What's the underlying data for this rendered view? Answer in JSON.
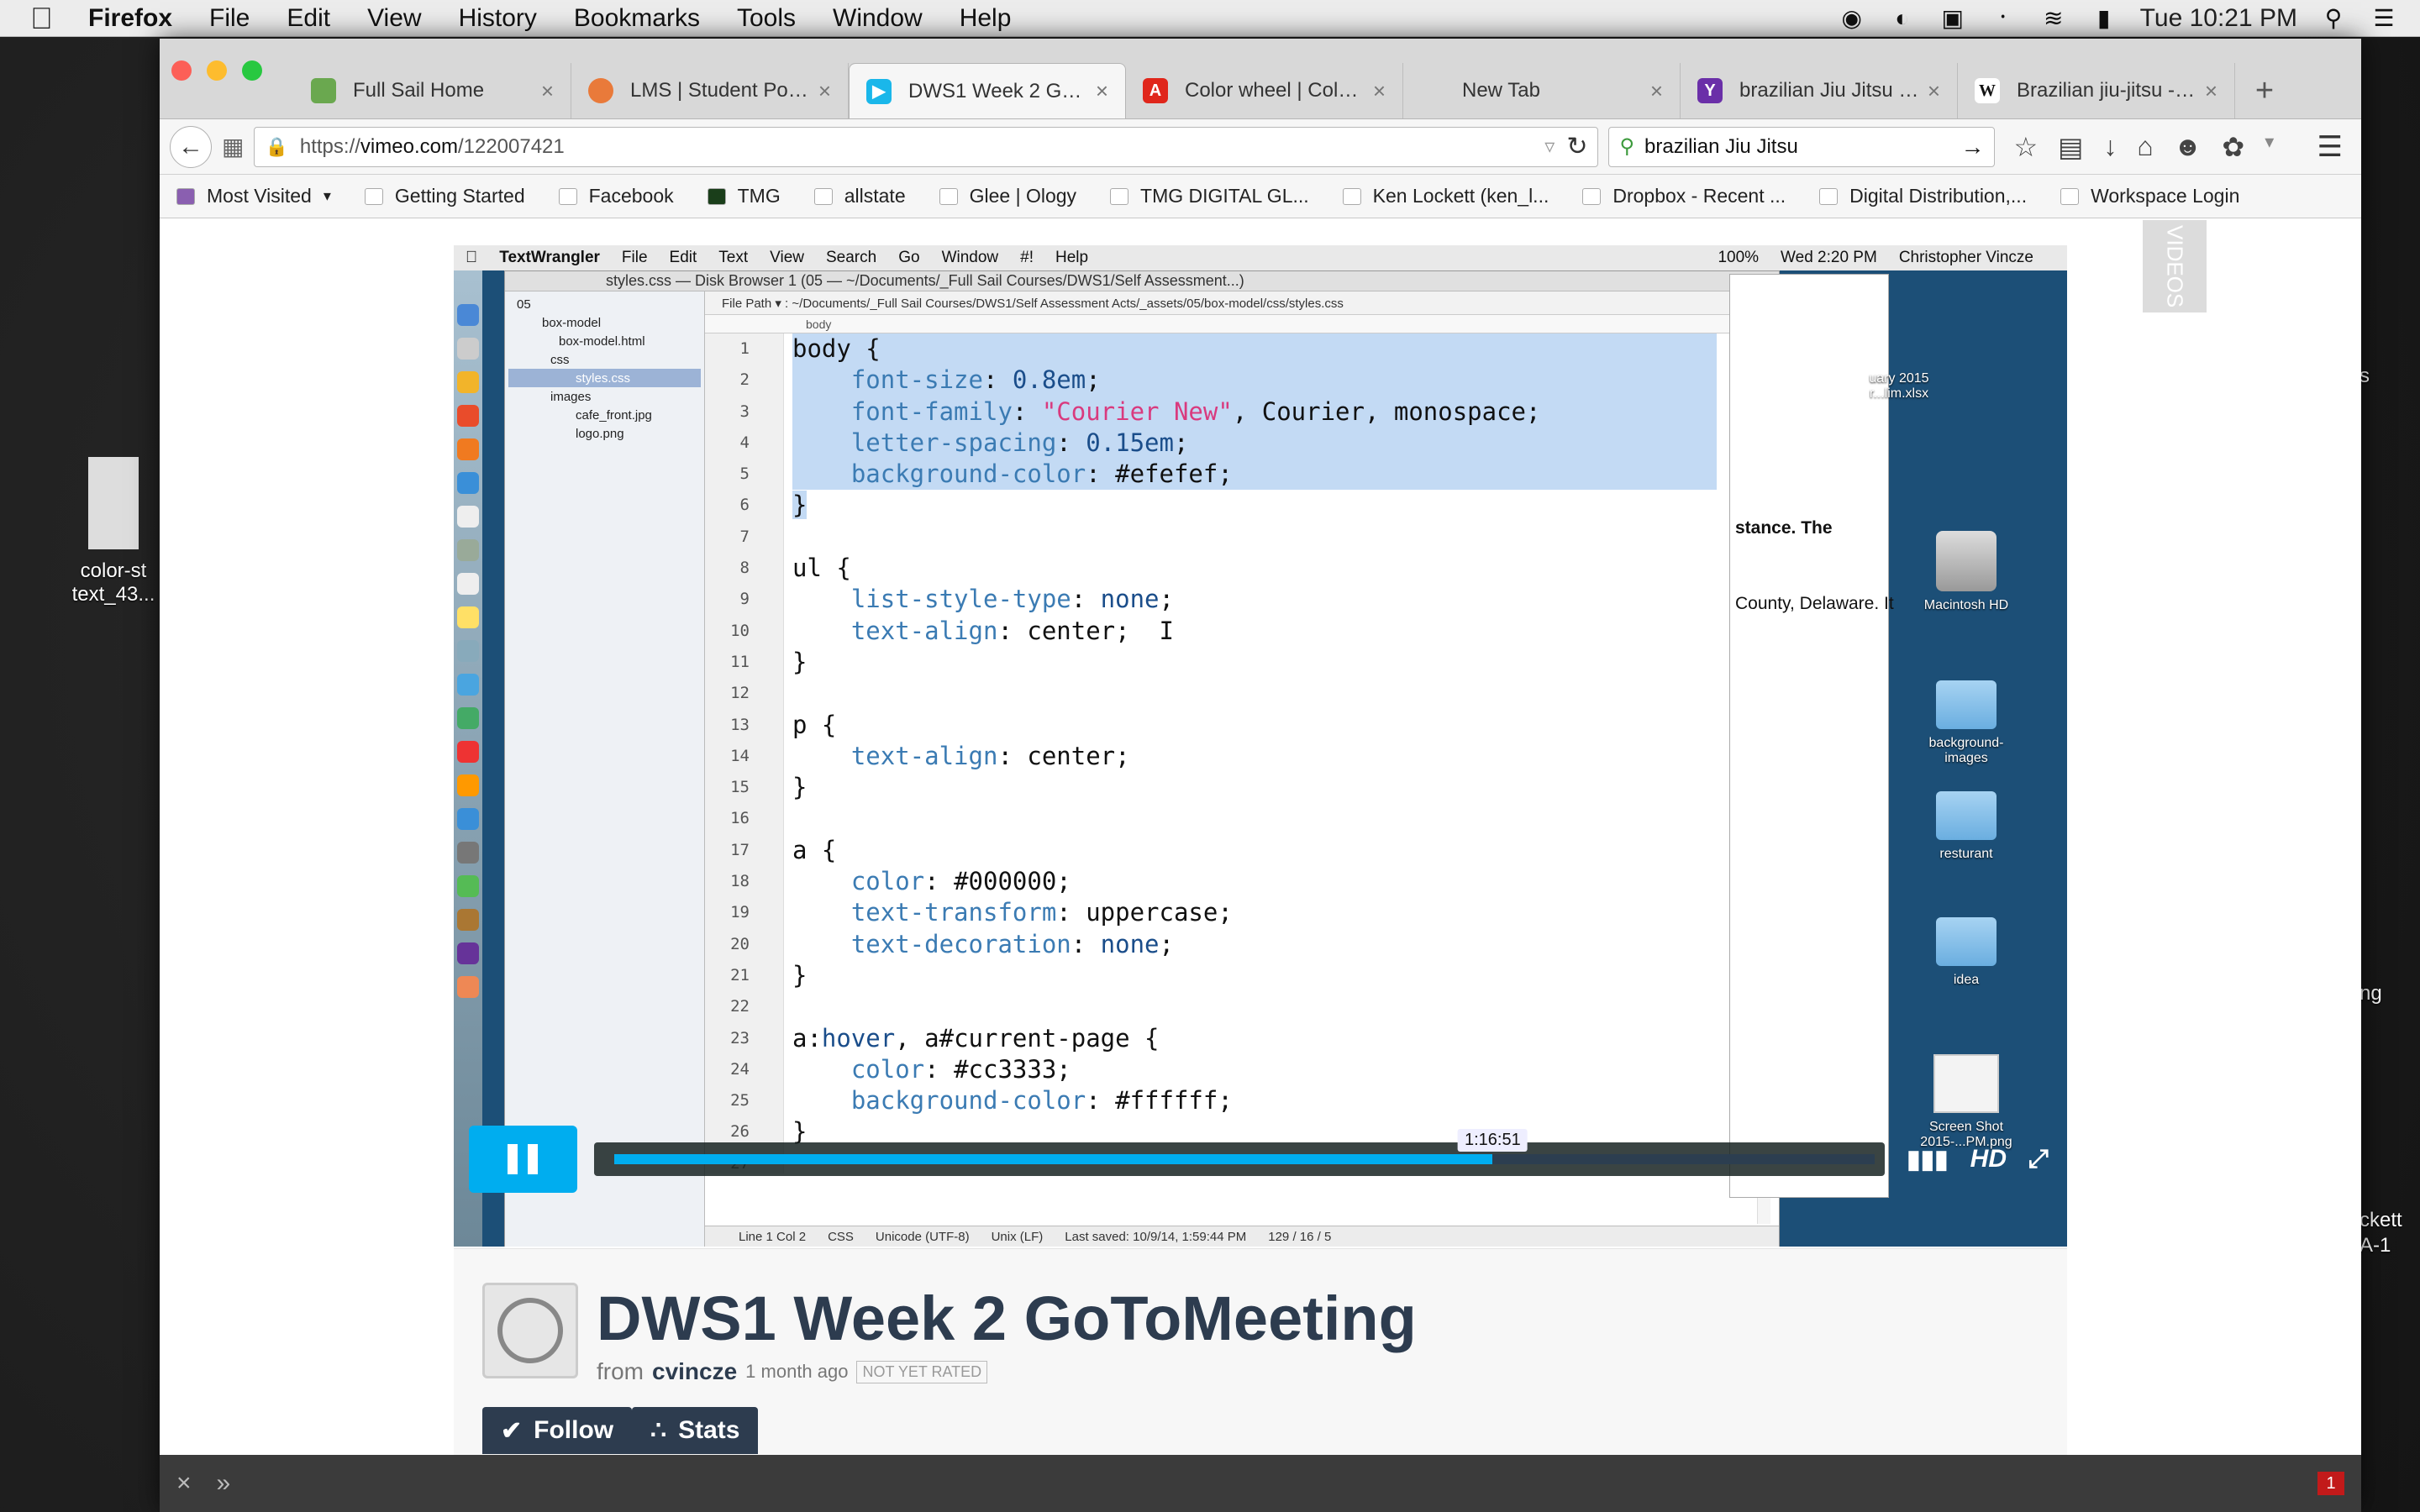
{
  "menubar": {
    "app": "Firefox",
    "items": [
      "File",
      "Edit",
      "View",
      "History",
      "Bookmarks",
      "Tools",
      "Window",
      "Help"
    ],
    "clock": "Tue 10:21 PM"
  },
  "desktop_left": {
    "label1": "color-st",
    "label2": "text_43..."
  },
  "desktop_right": {
    "label1": "ckett",
    "label2": "A-1",
    "label3": "ng",
    "label4": "s"
  },
  "tabs": [
    {
      "label": "Full Sail Home",
      "color": "#6aa84f"
    },
    {
      "label": "LMS | Student Portal",
      "color": "#e97a3a"
    },
    {
      "label": "DWS1 Week 2 GoT...",
      "color": "#1ab7ea"
    },
    {
      "label": "Color wheel | Color...",
      "color": "#e0261b"
    },
    {
      "label": "New Tab",
      "color": "#d8d8d8"
    },
    {
      "label": "brazilian Jiu Jitsu - ...",
      "color": "#6a2fa8"
    },
    {
      "label": "Brazilian jiu-jitsu - ...",
      "color": "#555555"
    }
  ],
  "nav": {
    "url_prefix": "https://",
    "url_host": "vimeo.com",
    "url_path": "/122007421",
    "search_value": "brazilian Jiu Jitsu"
  },
  "bookmarks": [
    "Most Visited",
    "Getting Started",
    "Facebook",
    "TMG",
    "allstate",
    "Glee | Ology",
    "TMG DIGITAL GL...",
    "Ken Lockett (ken_l...",
    "Dropbox - Recent ...",
    "Digital Distribution,...",
    "Workspace Login"
  ],
  "textwrangler": {
    "menu": [
      "TextWrangler",
      "File",
      "Edit",
      "Text",
      "View",
      "Search",
      "Go",
      "Window",
      "#!",
      "Help"
    ],
    "clock": "Wed 2:20 PM",
    "user": "Christopher Vincze",
    "battery": "100%",
    "window_title": "styles.css — Disk Browser 1 (05 — ~/Documents/_Full Sail Courses/DWS1/Self Assessment...)",
    "file_path": "File Path ▾ : ~/Documents/_Full Sail Courses/DWS1/Self Assessment Acts/_assets/05/box-model/css/styles.css",
    "crumb": "body",
    "tree": [
      "05",
      "box-model",
      "box-model.html",
      "css",
      "styles.css",
      "images",
      "cafe_front.jpg",
      "logo.png"
    ],
    "status": [
      "Line 1 Col 2",
      "CSS",
      "Unicode (UTF-8)",
      "Unix (LF)",
      "Last saved: 10/9/14, 1:59:44 PM",
      "129 / 16 / 5"
    ],
    "line_numbers": [
      "1",
      "2",
      "3",
      "4",
      "5",
      "6",
      "7",
      "8",
      "9",
      "10",
      "11",
      "12",
      "13",
      "14",
      "15",
      "16",
      "17",
      "18",
      "19",
      "20",
      "21",
      "22",
      "23",
      "24",
      "25",
      "26",
      "27"
    ]
  },
  "preview_text": {
    "a": "stance. The",
    "b": "County, Delaware. It"
  },
  "mini_desktop": [
    {
      "label": "uary 2015\nr...lim.xlsx"
    },
    {
      "label": "Macintosh HD"
    },
    {
      "label": "background-\nimages"
    },
    {
      "label": "resturant"
    },
    {
      "label": "idea"
    },
    {
      "label": "Screen Shot\n2015-...PM.png"
    }
  ],
  "player": {
    "timecode": "1:16:51",
    "progress": 0.697,
    "hd_label": "HD"
  },
  "video": {
    "title": "DWS1 Week 2 GoToMeeting",
    "from": "from",
    "author": "cvincze",
    "age": "1 month ago",
    "rating": "NOT YET RATED",
    "follow": "Follow",
    "stats": "Stats"
  },
  "side_tab": "VIDEOS",
  "footer_badge": "1"
}
